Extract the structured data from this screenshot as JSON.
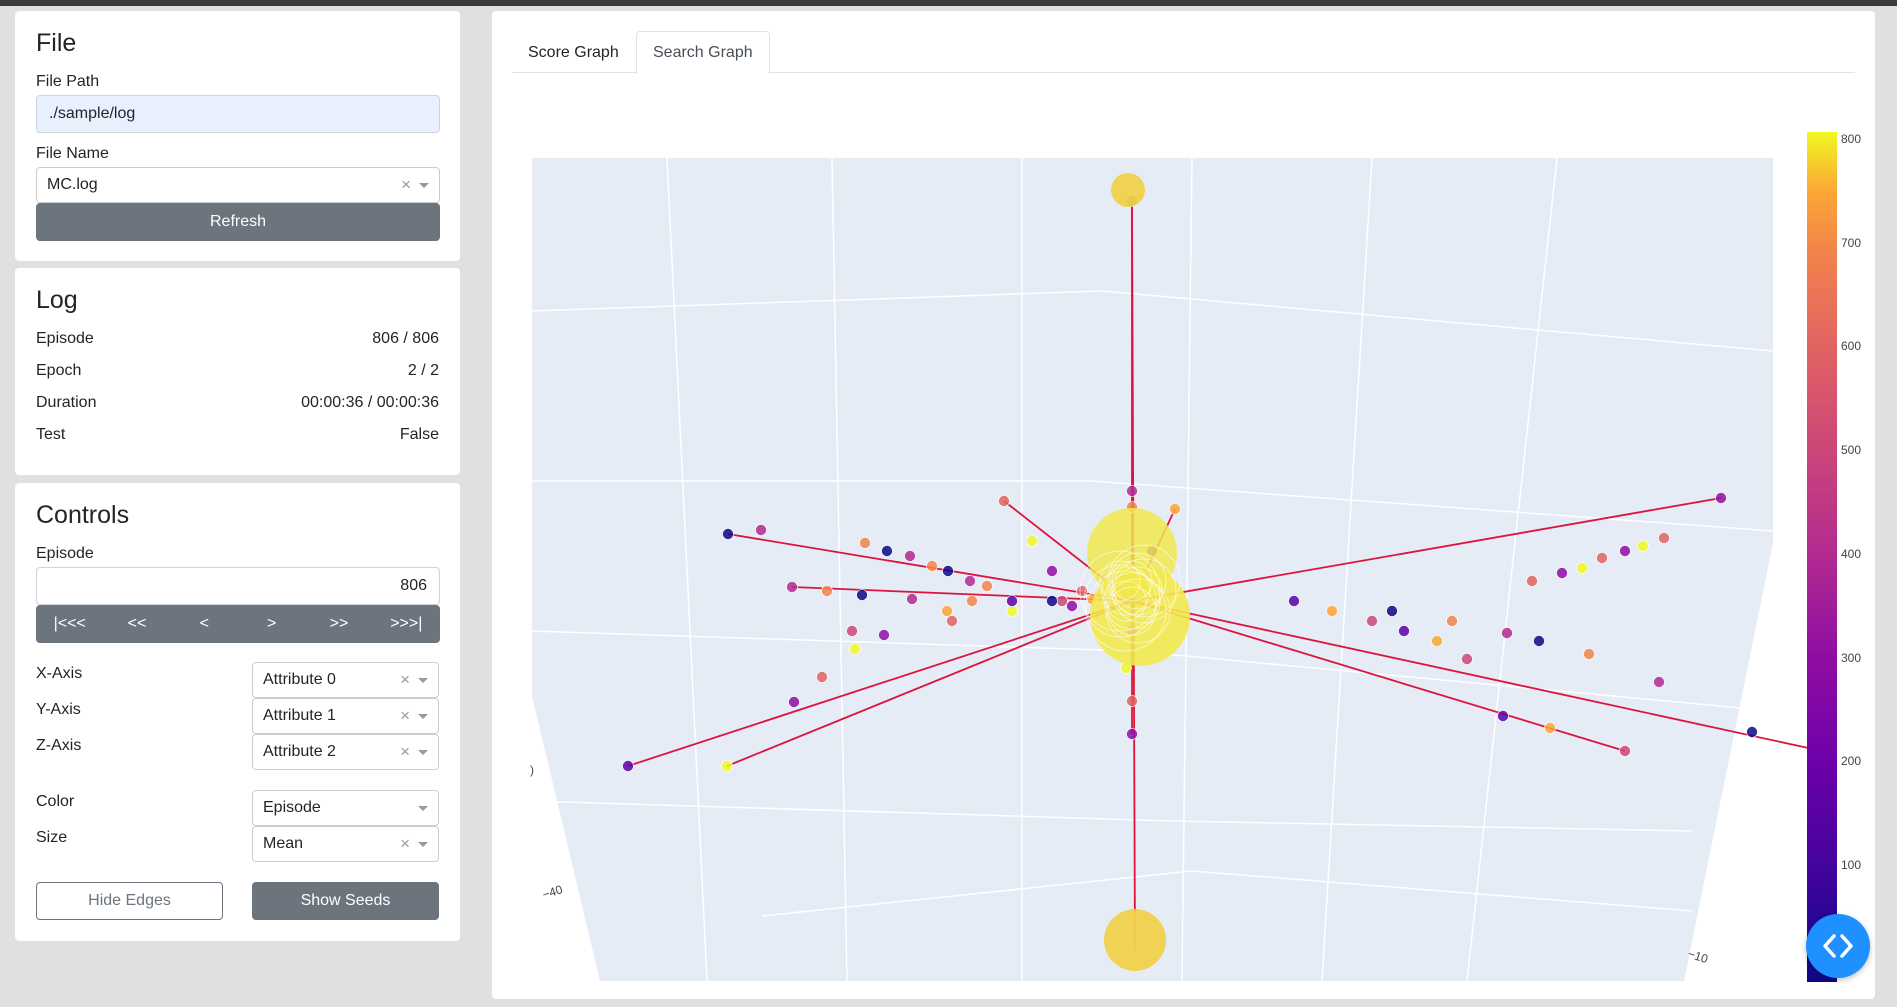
{
  "file": {
    "title": "File",
    "path_label": "File Path",
    "path_value": "./sample/log",
    "name_label": "File Name",
    "name_value": "MC.log",
    "refresh_label": "Refresh"
  },
  "log": {
    "title": "Log",
    "rows": [
      {
        "label": "Episode",
        "value": "806 / 806"
      },
      {
        "label": "Epoch",
        "value": "2 / 2"
      },
      {
        "label": "Duration",
        "value": "00:00:36 / 00:00:36"
      },
      {
        "label": "Test",
        "value": "False"
      }
    ]
  },
  "controls": {
    "title": "Controls",
    "episode_label": "Episode",
    "episode_value": "806",
    "nav": [
      "|<<<",
      "<<",
      "<",
      ">",
      ">>",
      ">>>|"
    ],
    "x_label": "X-Axis",
    "x_value": "Attribute 0",
    "y_label": "Y-Axis",
    "y_value": "Attribute 1",
    "z_label": "Z-Axis",
    "z_value": "Attribute 2",
    "color_label": "Color",
    "color_value": "Episode",
    "size_label": "Size",
    "size_value": "Mean",
    "hide_edges_label": "Hide Edges",
    "show_seeds_label": "Show Seeds"
  },
  "graph": {
    "tabs": [
      {
        "label": "Score Graph",
        "active": false
      },
      {
        "label": "Search Graph",
        "active": true
      }
    ],
    "axis_labels": [
      "−40",
      "−10",
      ")"
    ],
    "colorbar_ticks": [
      "800",
      "700",
      "600",
      "500",
      "400",
      "300",
      "200",
      "100"
    ]
  },
  "colors": {
    "accent": "#1e90ff",
    "button": "#6c757d",
    "edge": "#dc143c",
    "scene_bg": "#e5ecf6"
  },
  "icons": {
    "fab": "code-arrows-icon"
  }
}
